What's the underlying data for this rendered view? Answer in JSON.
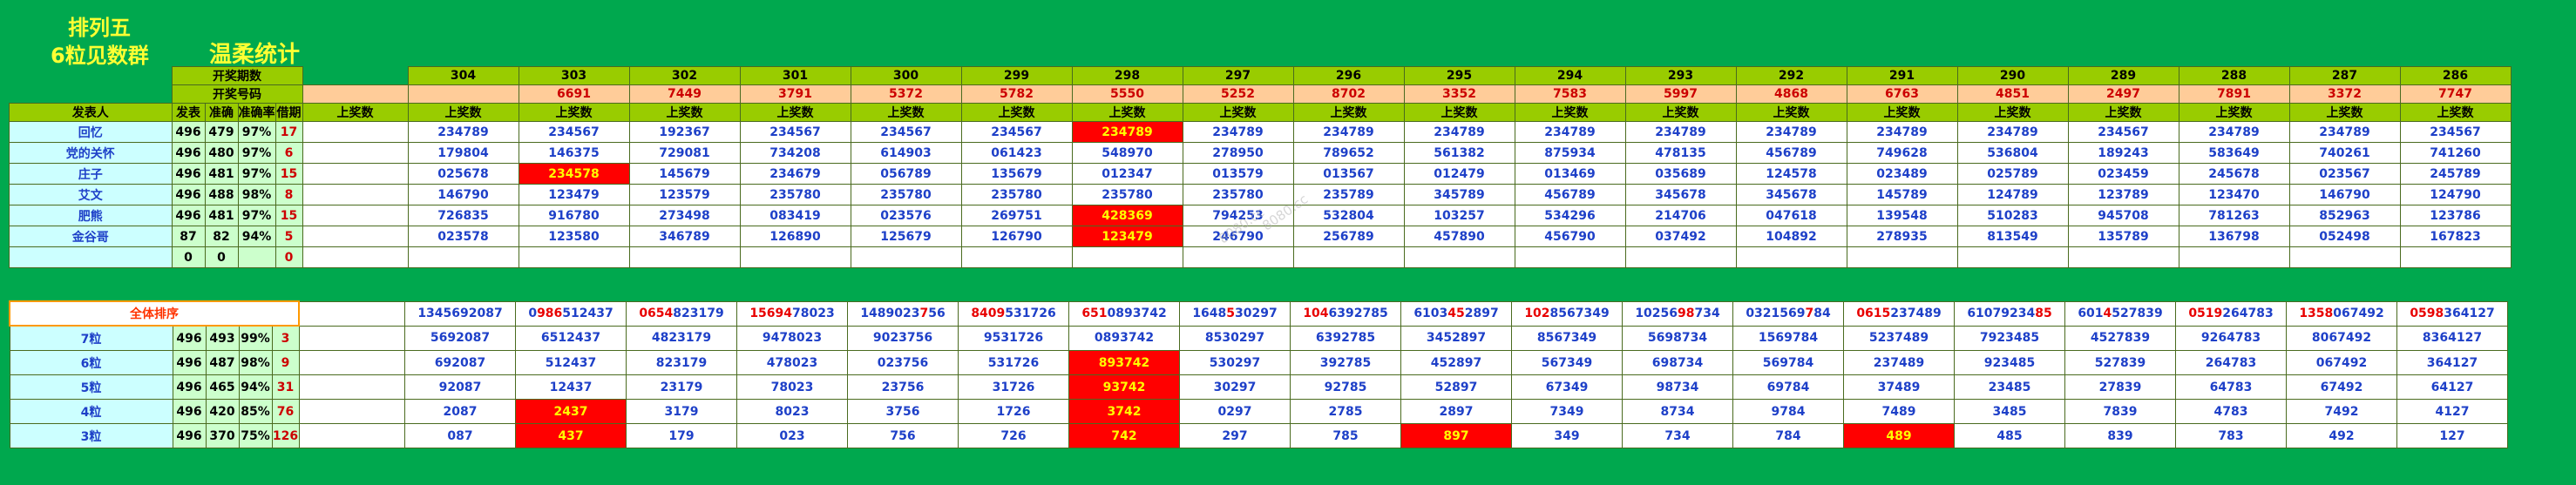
{
  "titles": {
    "main": "排列五",
    "sub": "6粒见数群",
    "sheet": "温柔统计"
  },
  "header": {
    "issue_label": "开奖期数",
    "number_label": "开奖号码",
    "publisher_label": "发表人",
    "stat_cols": [
      "发表",
      "准确",
      "准确率",
      "借期"
    ],
    "shang_label": "上奖数",
    "issues": [
      "304",
      "303",
      "302",
      "301",
      "300",
      "299",
      "298",
      "297",
      "296",
      "295",
      "294",
      "293",
      "292",
      "291",
      "290",
      "289",
      "288",
      "287",
      "286"
    ],
    "draws": [
      "",
      "6691",
      "7449",
      "3791",
      "5372",
      "5782",
      "5550",
      "5252",
      "8702",
      "3352",
      "7583",
      "5997",
      "4868",
      "6763",
      "4851",
      "2497",
      "7891",
      "3372",
      "7747"
    ]
  },
  "rows": [
    {
      "name": "回忆",
      "stats": [
        "496",
        "479",
        "97%",
        "17"
      ],
      "cells": [
        "234789",
        "234567",
        "192367",
        "234567",
        "234567",
        "234567",
        "234789",
        "234789",
        "234789",
        "234789",
        "234789",
        "234789",
        "234789",
        "234789",
        "234789",
        "234567",
        "234789",
        "234789",
        "234567"
      ],
      "hits": [
        6
      ]
    },
    {
      "name": "党的关怀",
      "stats": [
        "496",
        "480",
        "97%",
        "6"
      ],
      "cells": [
        "179804",
        "146375",
        "729081",
        "734208",
        "614903",
        "061423",
        "548970",
        "278950",
        "789652",
        "561382",
        "875934",
        "478135",
        "456789",
        "749628",
        "536804",
        "189243",
        "583649",
        "740261",
        "741260"
      ],
      "hits": []
    },
    {
      "name": "庄子",
      "stats": [
        "496",
        "481",
        "97%",
        "15"
      ],
      "cells": [
        "025678",
        "234578",
        "145679",
        "234679",
        "056789",
        "135679",
        "012347",
        "013579",
        "013567",
        "012479",
        "013469",
        "035689",
        "124578",
        "023489",
        "025789",
        "023459",
        "245678",
        "023567",
        "245789"
      ],
      "hits": [
        1
      ]
    },
    {
      "name": "艾文",
      "stats": [
        "496",
        "488",
        "98%",
        "8"
      ],
      "cells": [
        "146790",
        "123479",
        "123579",
        "235780",
        "235780",
        "235780",
        "235780",
        "235780",
        "235789",
        "345789",
        "456789",
        "345678",
        "345678",
        "145789",
        "124789",
        "123789",
        "123470",
        "146790",
        "124790"
      ],
      "hits": []
    },
    {
      "name": "肥熊",
      "stats": [
        "496",
        "481",
        "97%",
        "15"
      ],
      "cells": [
        "726835",
        "916780",
        "273498",
        "083419",
        "023576",
        "269751",
        "428369",
        "794253",
        "532804",
        "103257",
        "534296",
        "214706",
        "047618",
        "139548",
        "510283",
        "945708",
        "781263",
        "852963",
        "123786"
      ],
      "hits": [
        6
      ]
    },
    {
      "name": "金谷哥",
      "stats": [
        "87",
        "82",
        "94%",
        "5"
      ],
      "cells": [
        "023578",
        "123580",
        "346789",
        "126890",
        "125679",
        "126790",
        "123479",
        "246790",
        "256789",
        "457890",
        "456790",
        "037492",
        "104892",
        "278935",
        "813549",
        "135789",
        "136798",
        "052498",
        "167823"
      ],
      "hits": [
        6
      ]
    },
    {
      "name": "",
      "stats": [
        "0",
        "0",
        "",
        "0"
      ],
      "cells": [
        "",
        "",
        "",
        "",
        "",
        "",
        "",
        "",
        "",
        "",
        "",
        "",
        "",
        "",
        "",
        "",
        "",
        "",
        ""
      ],
      "hits": []
    }
  ],
  "ranking": {
    "label": "全体排序",
    "cells": [
      [
        "1345692087",
        ""
      ],
      [
        "0986512437",
        "986"
      ],
      [
        "0654823179",
        "0654"
      ],
      [
        "1569478023",
        "15694"
      ],
      [
        "1489023756",
        "7"
      ],
      [
        "8409531726",
        "8409"
      ],
      [
        "6510893742",
        "651"
      ],
      [
        "1648530297",
        "5"
      ],
      [
        "1046392785",
        "104"
      ],
      [
        "6103452897",
        "45"
      ],
      [
        "1028567349",
        "102"
      ],
      [
        "1025698734",
        "98"
      ],
      [
        "0321569784",
        "7"
      ],
      [
        "0615237489",
        "0615"
      ],
      [
        "6107923485",
        "85"
      ],
      [
        "6014527839",
        "4"
      ],
      [
        "0519264783",
        "0519"
      ],
      [
        "1358067492",
        "1358"
      ],
      [
        "0598364127",
        "0598"
      ]
    ]
  },
  "grain_rows": [
    {
      "name": "7粒",
      "stats": [
        "496",
        "493",
        "99%",
        "3"
      ],
      "cells": [
        "5692087",
        "6512437",
        "4823179",
        "9478023",
        "9023756",
        "9531726",
        "0893742",
        "8530297",
        "6392785",
        "3452897",
        "8567349",
        "5698734",
        "1569784",
        "5237489",
        "7923485",
        "4527839",
        "9264783",
        "8067492",
        "8364127"
      ],
      "hits": []
    },
    {
      "name": "6粒",
      "stats": [
        "496",
        "487",
        "98%",
        "9"
      ],
      "cells": [
        "692087",
        "512437",
        "823179",
        "478023",
        "023756",
        "531726",
        "893742",
        "530297",
        "392785",
        "452897",
        "567349",
        "698734",
        "569784",
        "237489",
        "923485",
        "527839",
        "264783",
        "067492",
        "364127"
      ],
      "hits": [
        6
      ]
    },
    {
      "name": "5粒",
      "stats": [
        "496",
        "465",
        "94%",
        "31"
      ],
      "cells": [
        "92087",
        "12437",
        "23179",
        "78023",
        "23756",
        "31726",
        "93742",
        "30297",
        "92785",
        "52897",
        "67349",
        "98734",
        "69784",
        "37489",
        "23485",
        "27839",
        "64783",
        "67492",
        "64127"
      ],
      "hits": [
        6
      ]
    },
    {
      "name": "4粒",
      "stats": [
        "496",
        "420",
        "85%",
        "76"
      ],
      "cells": [
        "2087",
        "2437",
        "3179",
        "8023",
        "3756",
        "1726",
        "3742",
        "0297",
        "2785",
        "2897",
        "7349",
        "8734",
        "9784",
        "7489",
        "3485",
        "7839",
        "4783",
        "7492",
        "4127"
      ],
      "hits": [
        1,
        6
      ]
    },
    {
      "name": "3粒",
      "stats": [
        "496",
        "370",
        "75%",
        "126"
      ],
      "cells": [
        "087",
        "437",
        "179",
        "023",
        "756",
        "726",
        "742",
        "297",
        "785",
        "897",
        "349",
        "734",
        "784",
        "489",
        "485",
        "839",
        "783",
        "492",
        "127"
      ],
      "hits": [
        1,
        6,
        9,
        13
      ]
    }
  ]
}
